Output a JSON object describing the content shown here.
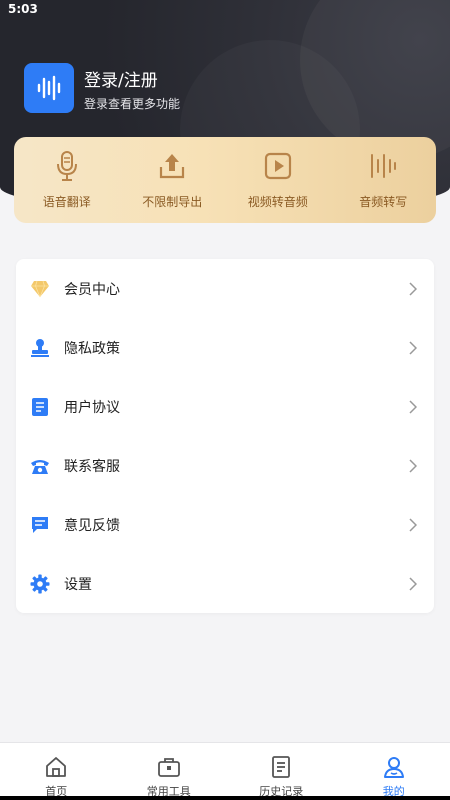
{
  "status_bar": {
    "time": "5:03"
  },
  "profile": {
    "title": "登录/注册",
    "subtitle": "登录查看更多功能",
    "logo_icon": "sound-wave-icon"
  },
  "quick_actions": [
    {
      "label": "语音翻译",
      "icon": "microphone-icon"
    },
    {
      "label": "不限制导出",
      "icon": "upload-icon"
    },
    {
      "label": "视频转音频",
      "icon": "play-icon"
    },
    {
      "label": "音频转写",
      "icon": "audio-bars-icon"
    }
  ],
  "menu": [
    {
      "label": "会员中心",
      "icon": "diamond-icon"
    },
    {
      "label": "隐私政策",
      "icon": "stamp-icon"
    },
    {
      "label": "用户协议",
      "icon": "document-icon"
    },
    {
      "label": "联系客服",
      "icon": "phone-icon"
    },
    {
      "label": "意见反馈",
      "icon": "message-icon"
    },
    {
      "label": "设置",
      "icon": "gear-icon"
    }
  ],
  "bottom_nav": [
    {
      "label": "首页",
      "icon": "home-icon",
      "active": false
    },
    {
      "label": "常用工具",
      "icon": "toolbox-icon",
      "active": false
    },
    {
      "label": "历史记录",
      "icon": "history-icon",
      "active": false
    },
    {
      "label": "我的",
      "icon": "user-icon",
      "active": true
    }
  ],
  "colors": {
    "accent": "#2e7cf6",
    "header_bg": "#2a2b33",
    "quick_text": "#8a5a23",
    "quick_icon": "#b8844a"
  }
}
